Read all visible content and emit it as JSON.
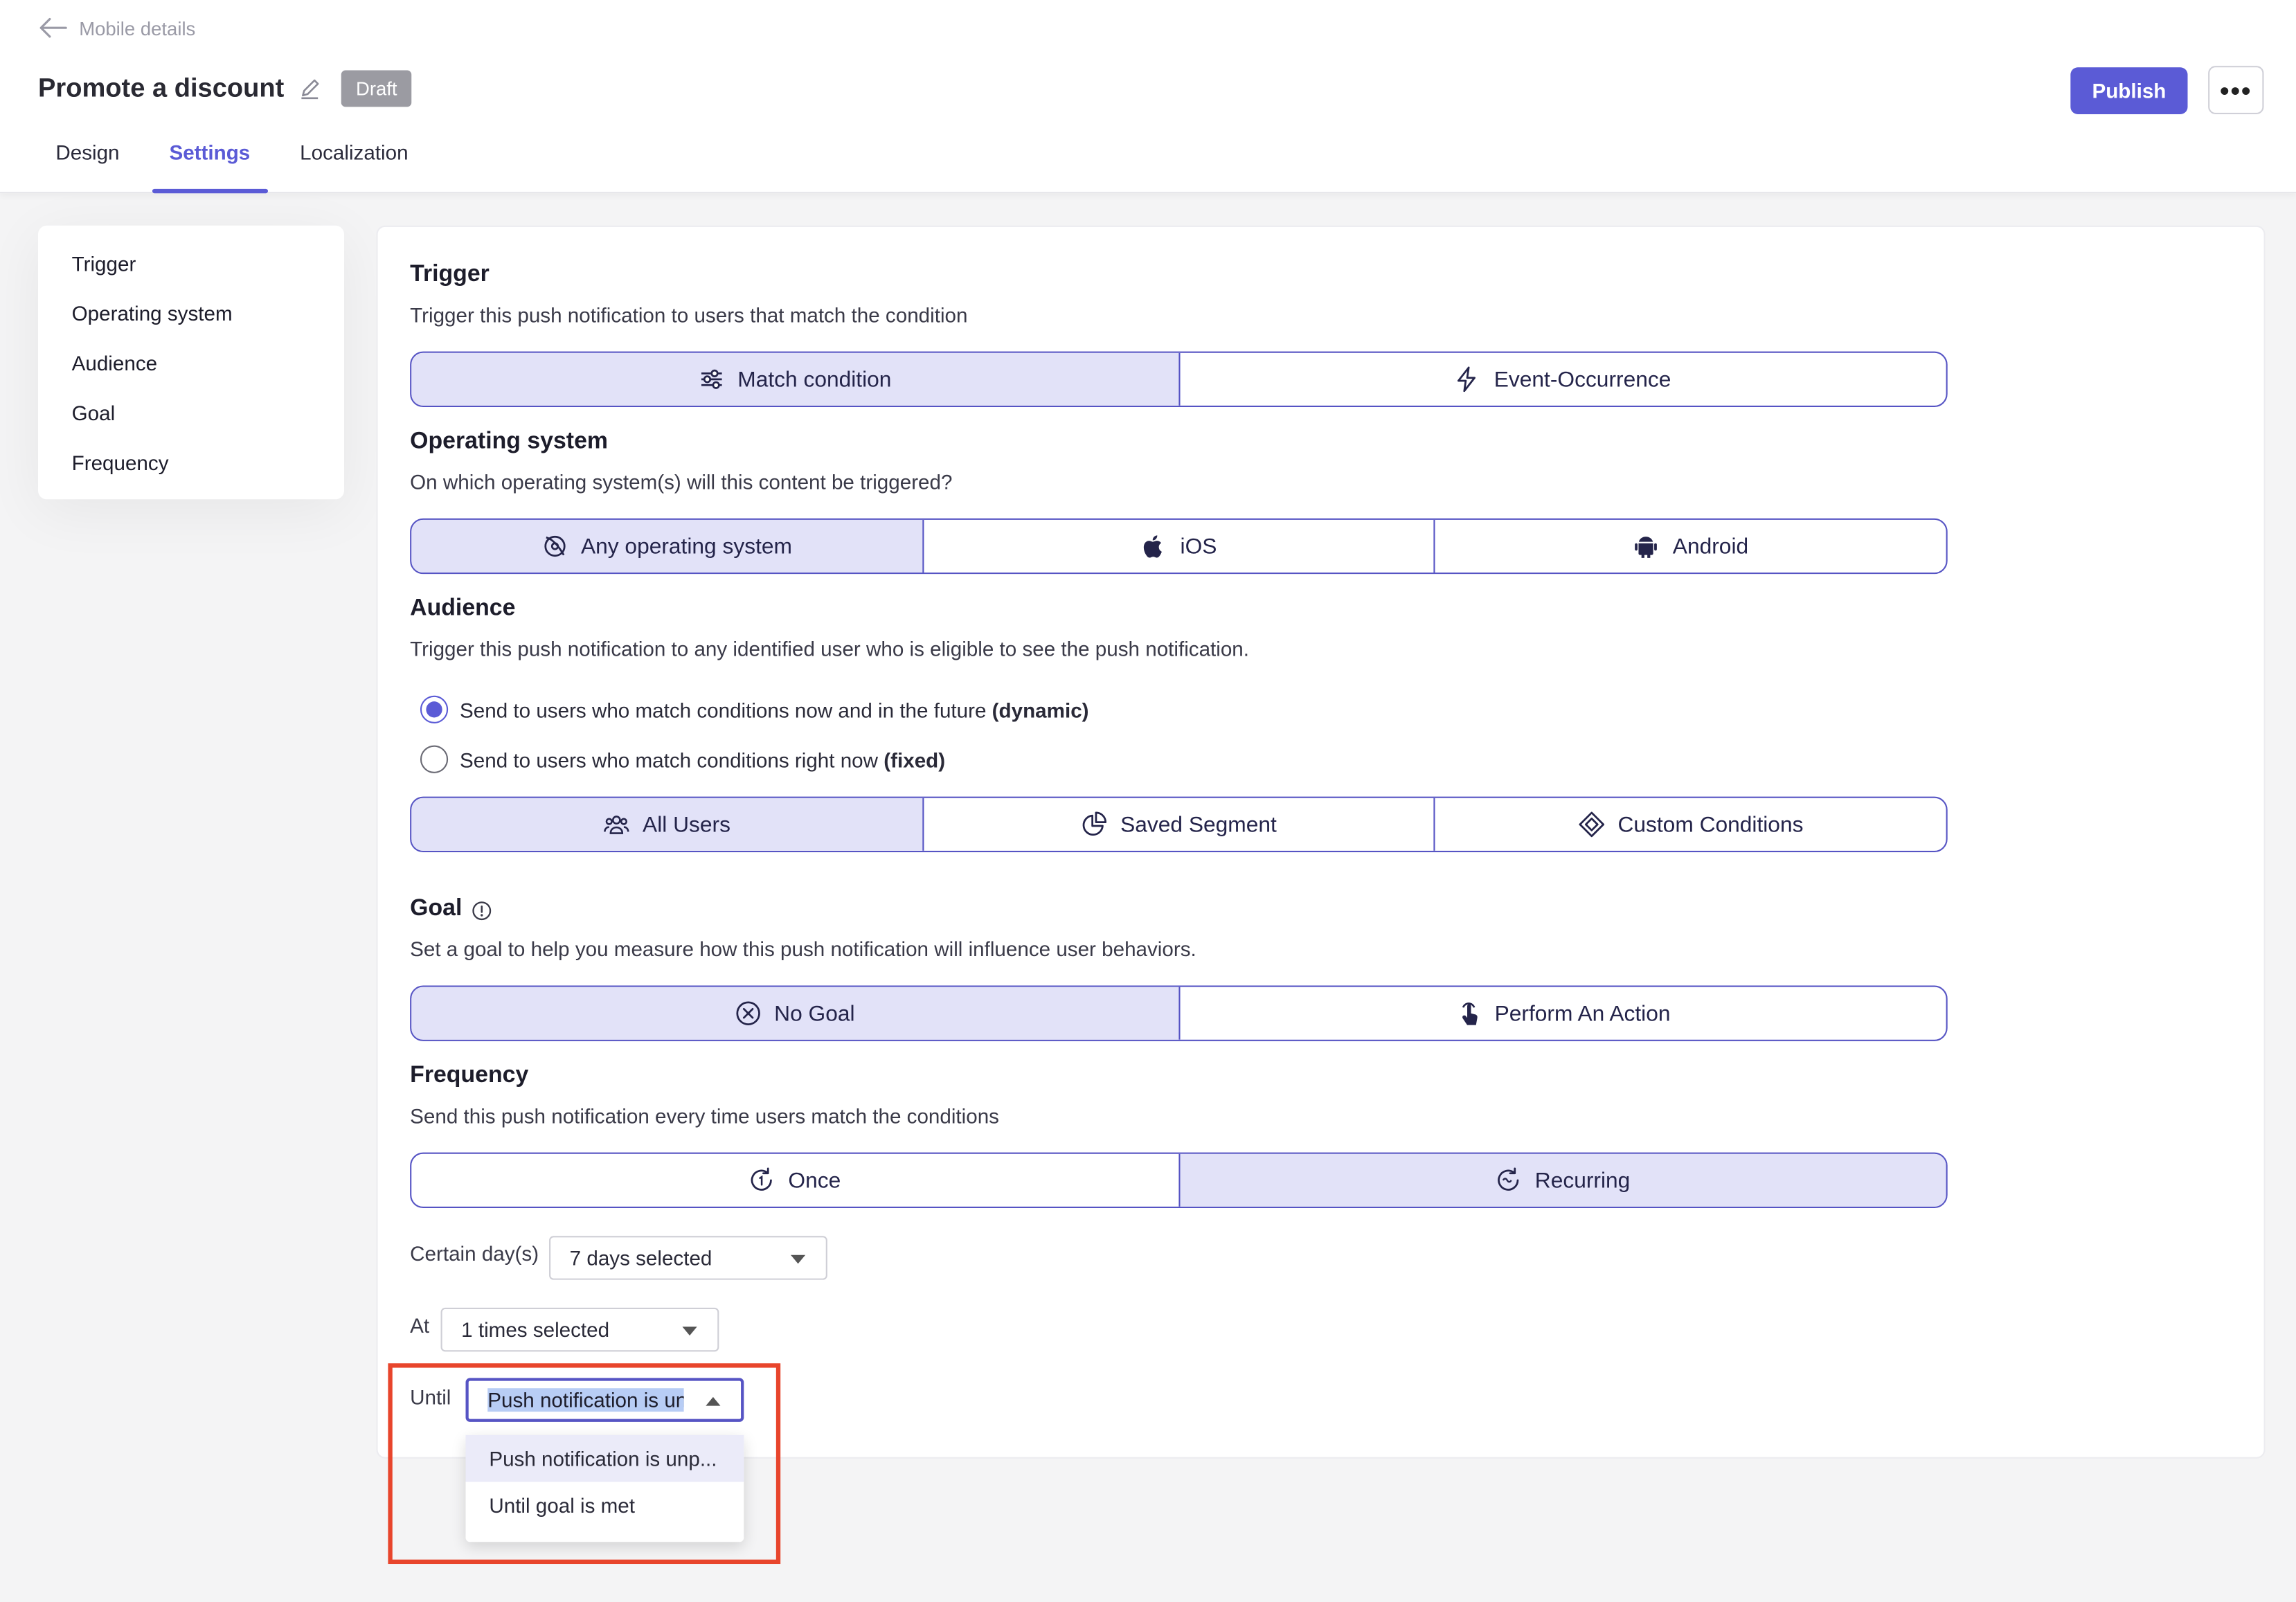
{
  "header": {
    "back_label": "Mobile details",
    "title": "Promote a discount",
    "status": "Draft",
    "publish_label": "Publish",
    "more_label": "•••",
    "tabs": [
      {
        "label": "Design"
      },
      {
        "label": "Settings"
      },
      {
        "label": "Localization"
      }
    ]
  },
  "sidenav": {
    "items": [
      {
        "label": "Trigger"
      },
      {
        "label": "Operating system"
      },
      {
        "label": "Audience"
      },
      {
        "label": "Goal"
      },
      {
        "label": "Frequency"
      }
    ]
  },
  "trigger": {
    "title": "Trigger",
    "description": "Trigger this push notification to users that match the condition",
    "options": [
      {
        "label": "Match condition",
        "icon": "sliders-icon",
        "selected": true
      },
      {
        "label": "Event-Occurrence",
        "icon": "lightning-icon",
        "selected": false
      }
    ]
  },
  "os": {
    "title": "Operating system",
    "description": "On which operating system(s) will this content be triggered?",
    "options": [
      {
        "label": "Any operating system",
        "icon": "any-os-icon",
        "selected": true
      },
      {
        "label": "iOS",
        "icon": "apple-icon",
        "selected": false
      },
      {
        "label": "Android",
        "icon": "android-icon",
        "selected": false
      }
    ]
  },
  "audience": {
    "title": "Audience",
    "description": "Trigger this push notification to any identified user who is eligible to see the push notification.",
    "radio_dynamic_text": "Send to users who match conditions now and in the future ",
    "radio_dynamic_bold": "(dynamic)",
    "radio_fixed_text": "Send to users who match conditions right now ",
    "radio_fixed_bold": "(fixed)",
    "selected_radio": "dynamic",
    "options": [
      {
        "label": "All Users",
        "icon": "users-icon",
        "selected": true
      },
      {
        "label": "Saved Segment",
        "icon": "pie-chart-icon",
        "selected": false
      },
      {
        "label": "Custom Conditions",
        "icon": "diamond-icon",
        "selected": false
      }
    ]
  },
  "goal": {
    "title": "Goal",
    "description": "Set a goal to help you measure how this push notification will influence user behaviors.",
    "options": [
      {
        "label": "No Goal",
        "icon": "circle-x-icon",
        "selected": true
      },
      {
        "label": "Perform An Action",
        "icon": "tap-icon",
        "selected": false
      }
    ]
  },
  "frequency": {
    "title": "Frequency",
    "description": "Send this push notification every time users match the conditions",
    "options": [
      {
        "label": "Once",
        "icon": "once-icon",
        "selected": false
      },
      {
        "label": "Recurring",
        "icon": "recurring-icon",
        "selected": true
      }
    ],
    "days_label": "Certain day(s)",
    "days_value": "7 days selected",
    "at_label": "At",
    "at_value": "1 times selected",
    "until_label": "Until",
    "until_value": "Push notification is un",
    "until_options": [
      {
        "label": "Push notification is unp..."
      },
      {
        "label": "Until goal is met"
      }
    ]
  },
  "colors": {
    "accent": "#5b5bd6",
    "segment_selected": "#e2e2f8",
    "segment_border": "#5654c4",
    "draft_badge": "#9b9ba2",
    "annotation_box": "#e8452c"
  }
}
